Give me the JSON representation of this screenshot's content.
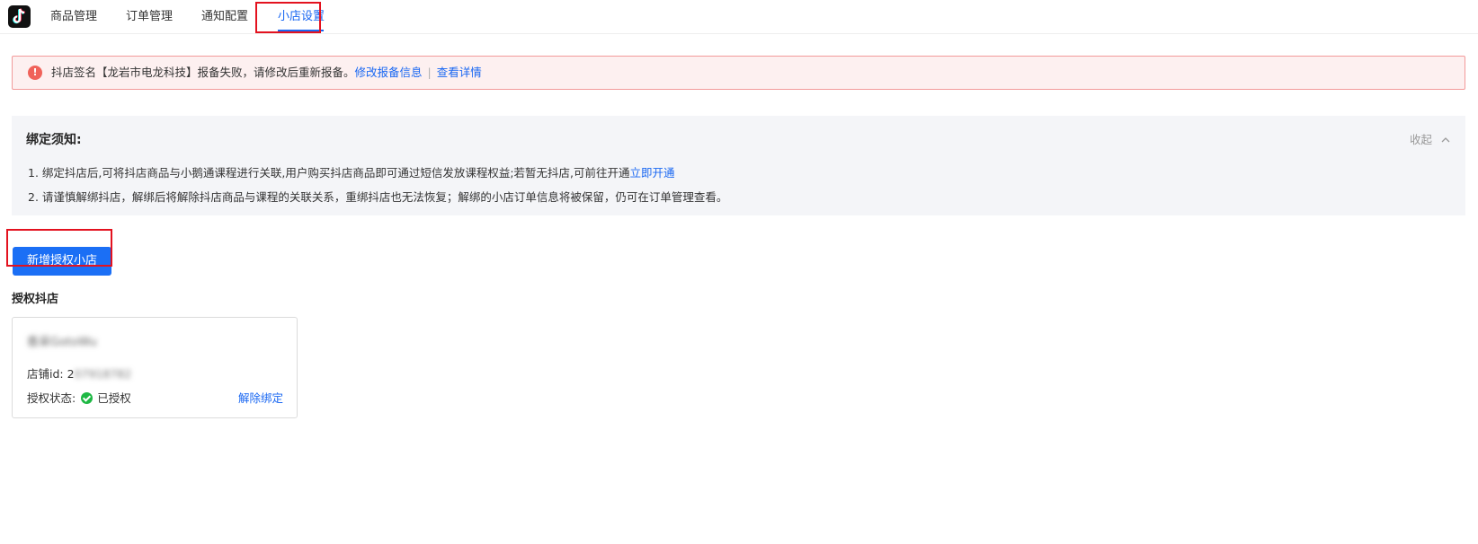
{
  "nav": {
    "tabs": [
      {
        "label": "商品管理"
      },
      {
        "label": "订单管理"
      },
      {
        "label": "通知配置"
      },
      {
        "label": "小店设置",
        "active": true
      }
    ]
  },
  "alert": {
    "message": "抖店签名【龙岩市电龙科技】报备失败，请修改后重新报备。",
    "link_modify": "修改报备信息",
    "separator": "|",
    "link_details": "查看详情"
  },
  "notice": {
    "title": "绑定须知:",
    "collapse_label": "收起",
    "line1_text": "1.  绑定抖店后,可将抖店商品与小鹅通课程进行关联,用户购买抖店商品即可通过短信发放课程权益;若暂无抖店,可前往开通",
    "line1_link": "立即开通",
    "line2_text": "2.  请谨慎解绑抖店，解绑后将解除抖店商品与课程的关联关系，重绑抖店也无法恢复；解绑的小店订单信息将被保留，仍可在订单管理查看。"
  },
  "add_button_label": "新增授权小店",
  "section_title": "授权抖店",
  "shop_card": {
    "name": "香采GotoWu",
    "id_label": "店铺id: 2",
    "id_value": "07918782",
    "status_label": "授权状态:",
    "status_value": "已授权",
    "unbind_label": "解除绑定"
  },
  "colors": {
    "accent": "#1b6ff5",
    "error": "#f0625a",
    "success": "#1eb844",
    "highlight_box": "#e3121f"
  }
}
